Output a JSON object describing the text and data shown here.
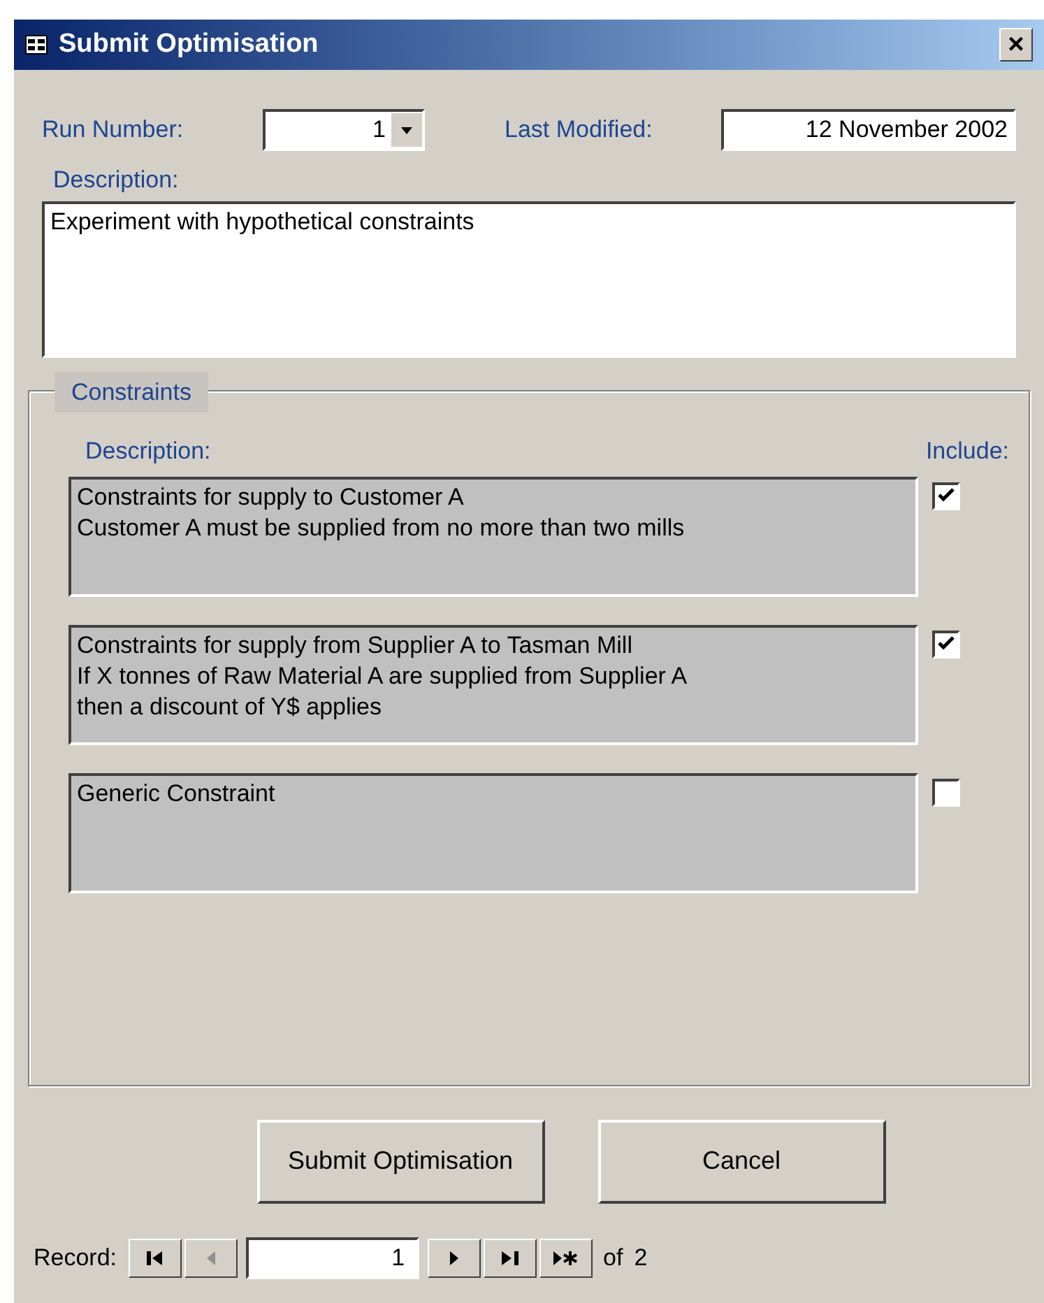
{
  "window": {
    "title": "Submit Optimisation",
    "close": "×"
  },
  "run_number": {
    "label": "Run Number:",
    "value": "1"
  },
  "last_modified": {
    "label": "Last Modified:",
    "value": "12 November 2002"
  },
  "description": {
    "label": "Description:",
    "value": "Experiment with hypothetical constraints"
  },
  "constraints": {
    "legend": "Constraints",
    "description_label": "Description:",
    "include_label": "Include:",
    "items": [
      {
        "text": "Constraints for supply to Customer A\nCustomer A must be supplied from no more than two mills",
        "checked": true
      },
      {
        "text": "Constraints for supply from Supplier A to Tasman Mill\nIf X tonnes of Raw Material A are supplied from Supplier A\nthen a discount of Y$ applies",
        "checked": true
      },
      {
        "text": "Generic Constraint",
        "checked": false
      }
    ]
  },
  "buttons": [
    "Submit Optimisation",
    "Cancel"
  ],
  "record_nav": {
    "label": "Record:",
    "value": "1",
    "of": "of",
    "total": "2"
  }
}
